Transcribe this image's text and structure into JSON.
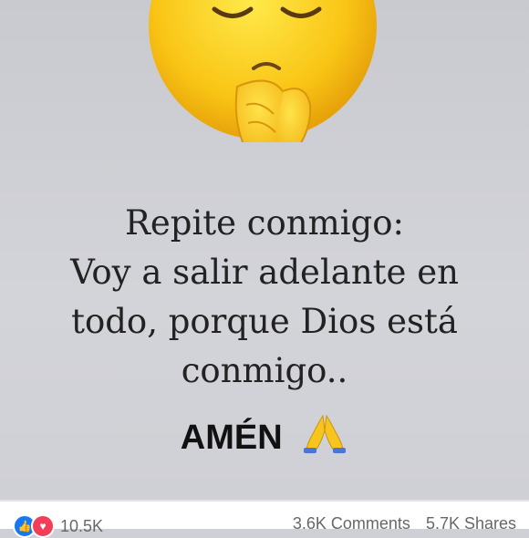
{
  "post": {
    "message_lines": [
      "Repite conmigo:",
      "Voy a salir adelante en",
      "todo, porque Dios está",
      "conmigo.."
    ],
    "closing": "AMÉN",
    "emoji": "praying-face-emoji",
    "closing_icon": "praying-hands-icon"
  },
  "stats": {
    "reactions_count": "10.5K",
    "comments": "3.6K Comments",
    "shares": "5.7K Shares"
  },
  "colors": {
    "background": "#cfd0d5",
    "emoji_yellow": "#f7c51e",
    "like_blue": "#1877f2",
    "love_red": "#f33e58"
  }
}
